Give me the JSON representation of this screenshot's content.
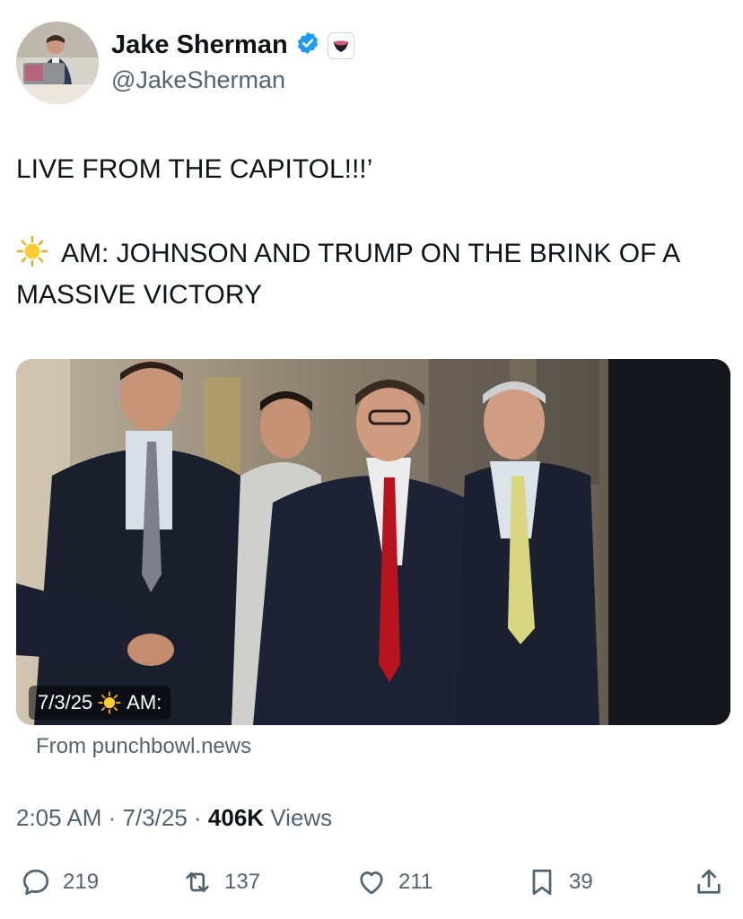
{
  "author": {
    "name": "Jake Sherman",
    "handle": "@JakeSherman",
    "verified_icon": "verified-badge-icon",
    "affiliate_icon": "punchbowl-affiliate-icon",
    "verified_color": "#1d9bf0"
  },
  "tweet": {
    "line1": "LIVE FROM THE CAPITOL!!!’",
    "line2_prefix_icon": "sun-emoji",
    "line2": "AM: JOHNSON AND TRUMP ON THE BRINK OF A MASSIVE VICTORY"
  },
  "card": {
    "caption_date": "7/3/25",
    "caption_icon": "sun-emoji",
    "caption_text": "AM:",
    "source": "From punchbowl.news"
  },
  "meta": {
    "time": "2:05 AM",
    "sep1": " · ",
    "date": "7/3/25",
    "sep2": " · ",
    "views_count": "406K",
    "views_label": " Views"
  },
  "actions": {
    "replies": "219",
    "reposts": "137",
    "likes": "211",
    "bookmarks": "39"
  }
}
